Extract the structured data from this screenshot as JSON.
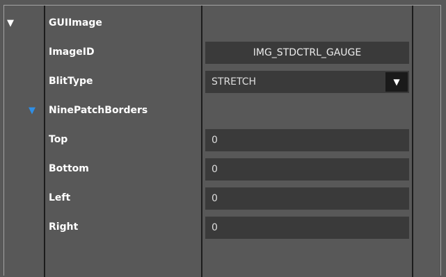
{
  "tree": {
    "gui_image": {
      "label": "GUIImage",
      "expand_icon": "triangle-down-icon"
    },
    "image_id": {
      "label": "ImageID",
      "value": "IMG_STDCTRL_GAUGE"
    },
    "blit_type": {
      "label": "BlitType",
      "value": "STRETCH",
      "dropdown_icon": "triangle-down-icon"
    },
    "nine_patch": {
      "label": "NinePatchBorders",
      "expand_icon": "triangle-down-icon",
      "icon_color": "#2f8fe6"
    },
    "top": {
      "label": "Top",
      "value": "0"
    },
    "bottom": {
      "label": "Bottom",
      "value": "0"
    },
    "left": {
      "label": "Left",
      "value": "0"
    },
    "right": {
      "label": "Right",
      "value": "0"
    }
  },
  "glyphs": {
    "triangle_down": "▼"
  }
}
